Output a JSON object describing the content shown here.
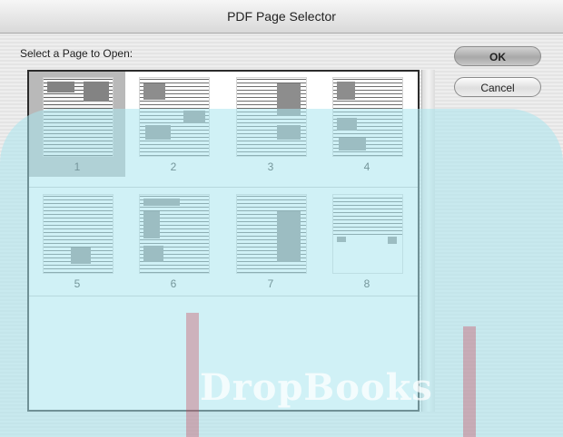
{
  "window": {
    "title": "PDF Page Selector"
  },
  "prompt": "Select a Page to Open:",
  "buttons": {
    "ok": "OK",
    "cancel": "Cancel"
  },
  "pages": [
    "1",
    "2",
    "3",
    "4",
    "5",
    "6",
    "7",
    "8"
  ],
  "selected_page": "1",
  "watermark": "DropBooks"
}
